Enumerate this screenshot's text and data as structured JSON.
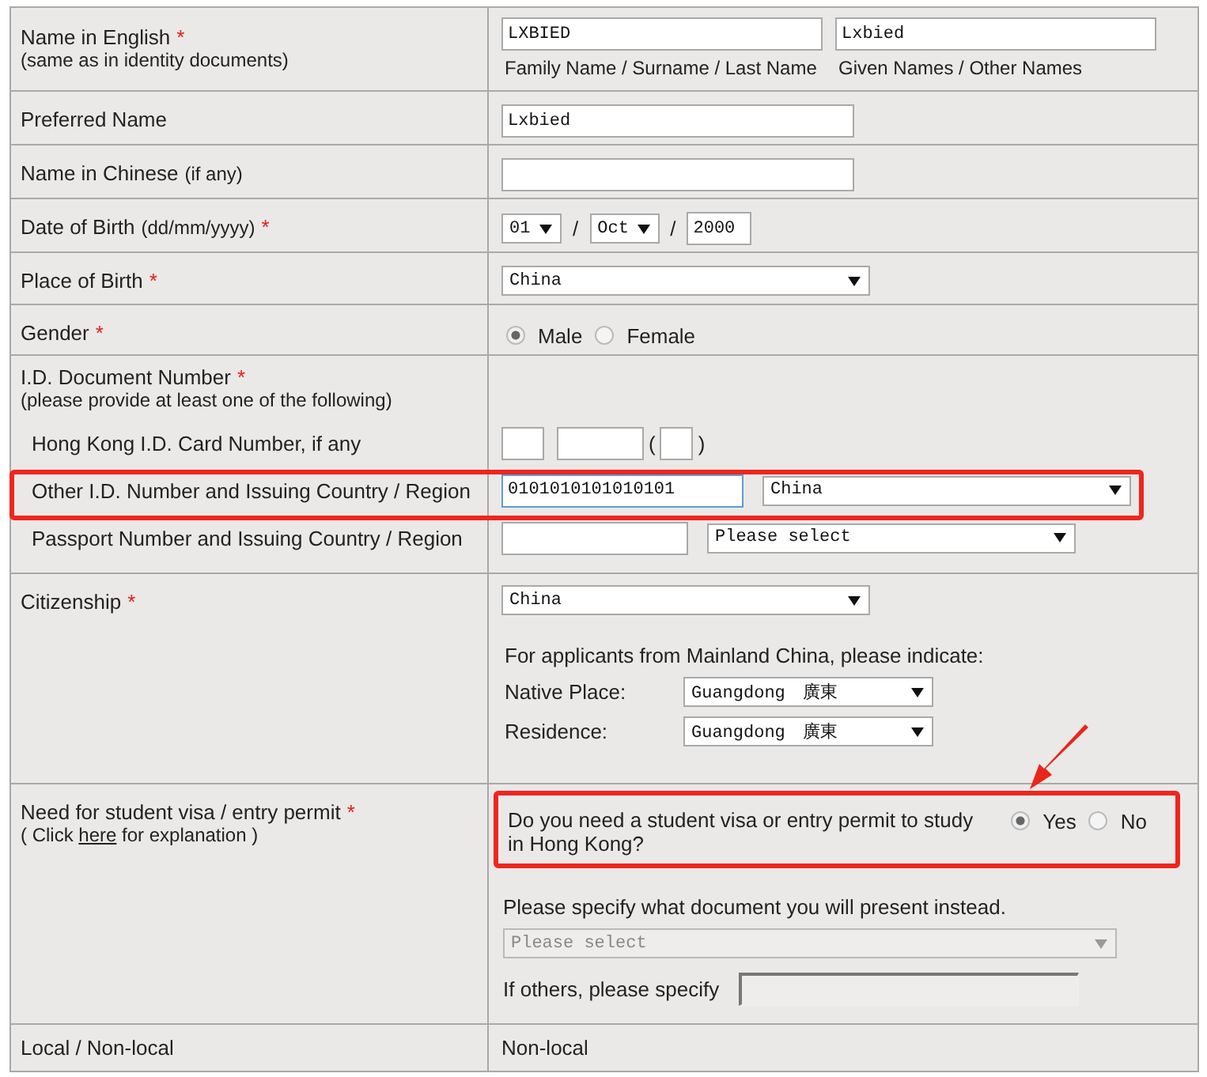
{
  "name_english": {
    "label": "Name in English",
    "mark": "*",
    "note": "(same as in identity documents)",
    "inputs": [
      {
        "value": "LXBIED",
        "caption": "Family Name / Surname / Last Name"
      },
      {
        "value": "Lxbied",
        "caption": "Given Names / Other Names"
      }
    ]
  },
  "preferred_name": {
    "label": "Preferred Name",
    "value": "Lxbied"
  },
  "name_chinese": {
    "label": "Name in Chinese",
    "hint": "(if any)"
  },
  "date_of_birth": {
    "label": "Date of Birth",
    "hint": "(dd/mm/yyyy)",
    "mark": "*",
    "day": "01",
    "separator_1": "/",
    "month": "Oct",
    "separator_2": "/",
    "year": "2000"
  },
  "place_of_birth": {
    "label": "Place of Birth",
    "mark": "*",
    "value": "China"
  },
  "gender": {
    "label": "Gender",
    "mark": "*",
    "options": [
      {
        "label": "Male",
        "selected": true
      },
      {
        "label": "Female",
        "selected": false
      }
    ]
  },
  "id_document": {
    "label": "I.D. Document Number",
    "mark": "*",
    "note": "(please provide at least one of the following)",
    "hk_id": {
      "label": "Hong Kong I.D. Card Number, if any",
      "open": "(",
      "close": ")"
    },
    "other_id": {
      "label": "Other I.D. Number and Issuing Country / Region",
      "value": "0101010101010101",
      "country": "China",
      "focused": true,
      "highlighted": true
    },
    "passport": {
      "label": "Passport Number and Issuing Country / Region",
      "country": "Please select"
    }
  },
  "citizenship": {
    "label": "Citizenship",
    "mark": "*",
    "value": "China",
    "note": "For applicants from Mainland China, please indicate:",
    "native_place": {
      "label": "Native Place:",
      "value": "Guangdong　廣東"
    },
    "residence": {
      "label": "Residence:",
      "value": "Guangdong　廣東"
    }
  },
  "visa": {
    "label": "Need for student visa / entry permit",
    "mark": "*",
    "hint_before": "( Click ",
    "link": "here",
    "hint_after": " for explanation )",
    "question": "Do you need a student visa or entry permit to study in Hong Kong?",
    "highlighted": true,
    "pointer_arrow": true,
    "options": [
      {
        "label": "Yes",
        "selected": true
      },
      {
        "label": "No",
        "selected": false
      }
    ],
    "instruction": "Please specify what document you will present instead.",
    "document": {
      "placeholder": "Please select",
      "disabled": true
    },
    "others": {
      "label": "If others, please specify",
      "disabled": true
    }
  },
  "local_status": {
    "label": "Local / Non-local",
    "value": "Non-local"
  }
}
